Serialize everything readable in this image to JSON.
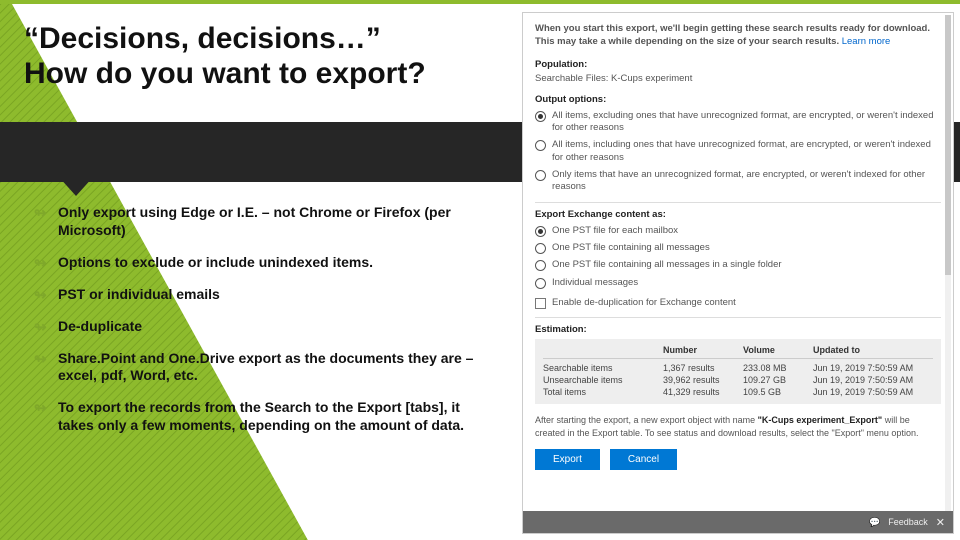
{
  "slide": {
    "title_line1": "“Decisions, decisions…”",
    "title_line2": "How do you want to export?",
    "bullets": [
      "Only export using Edge or I.E. – not Chrome or Firefox (per Microsoft)",
      "Options to exclude or include unindexed items.",
      "PST or individual emails",
      "De-duplicate",
      "Share.Point and One.Drive export as the documents they are – excel, pdf, Word, etc.",
      "To export the records from the Search to the Export [tabs], it takes only a few moments, depending on the amount of data."
    ]
  },
  "panel": {
    "intro": "When you start this export, we'll begin getting these search results ready for download. This may take a while depending on the size of your search results.",
    "learn_more": "Learn more",
    "population_label": "Population:",
    "population_value": "Searchable Files:  K-Cups experiment",
    "output_label": "Output options:",
    "output_options": [
      "All items, excluding ones that have unrecognized format, are encrypted, or weren't indexed for other reasons",
      "All items, including ones that have unrecognized format, are encrypted, or weren't indexed for other reasons",
      "Only items that have an unrecognized format, are encrypted, or weren't indexed for other reasons"
    ],
    "exchange_label": "Export Exchange content as:",
    "exchange_options": [
      "One PST file for each mailbox",
      "One PST file containing all messages",
      "One PST file containing all messages in a single folder",
      "Individual messages"
    ],
    "dedupe": "Enable de-duplication for Exchange content",
    "estimation_label": "Estimation:",
    "est_headers": {
      "c1": "",
      "c2": "Number",
      "c3": "Volume",
      "c4": "Updated to"
    },
    "est_rows": [
      {
        "c1": "Searchable items",
        "c2": "1,367 results",
        "c3": "233.08 MB",
        "c4": "Jun 19, 2019 7:50:59 AM"
      },
      {
        "c1": "Unsearchable items",
        "c2": "39,962 results",
        "c3": "109.27 GB",
        "c4": "Jun 19, 2019 7:50:59 AM"
      },
      {
        "c1": "Total items",
        "c2": "41,329 results",
        "c3": "109.5 GB",
        "c4": "Jun 19, 2019 7:50:59 AM"
      }
    ],
    "afternote_a": "After starting the export, a new export object with name ",
    "afternote_b": "\"K-Cups experiment_Export\"",
    "afternote_c": " will be created in the Export table. To see status and download results, select the \"Export\" menu option.",
    "export_btn": "Export",
    "cancel_btn": "Cancel",
    "feedback": "Feedback",
    "close": "✕"
  }
}
